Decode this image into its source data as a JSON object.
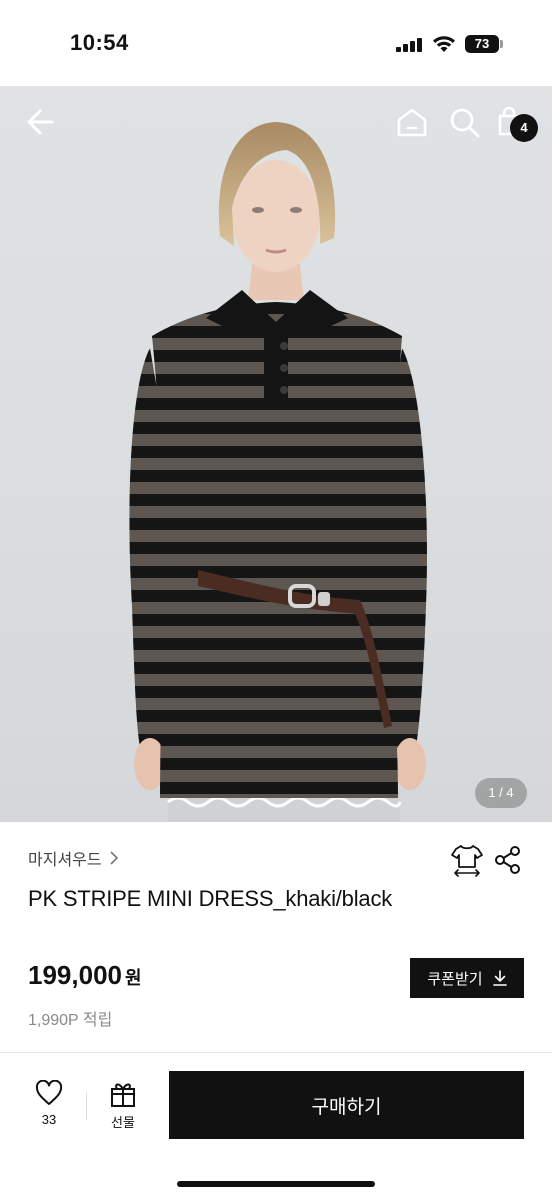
{
  "status_bar": {
    "time": "10:54",
    "battery": "73"
  },
  "header": {
    "cart_count": "4"
  },
  "gallery": {
    "page_indicator": "1 / 4"
  },
  "product": {
    "brand": "마지셔우드",
    "title": "PK STRIPE MINI DRESS_khaki/black",
    "price": "199,000",
    "price_unit": "원",
    "points": "1,990P 적립"
  },
  "coupon": {
    "label": "쿠폰받기"
  },
  "actions": {
    "like_count": "33",
    "gift_label": "선물",
    "buy_label": "구매하기"
  },
  "colors": {
    "accent": "#111111",
    "muted": "#8a8a8a",
    "stripe_khaki": "#5e5650",
    "stripe_black": "#151516"
  },
  "icons": [
    "back-arrow-icon",
    "home-icon",
    "search-icon",
    "shopping-bag-icon",
    "chevron-right-icon",
    "shirt-size-icon",
    "share-icon",
    "download-icon",
    "heart-icon",
    "gift-icon"
  ]
}
